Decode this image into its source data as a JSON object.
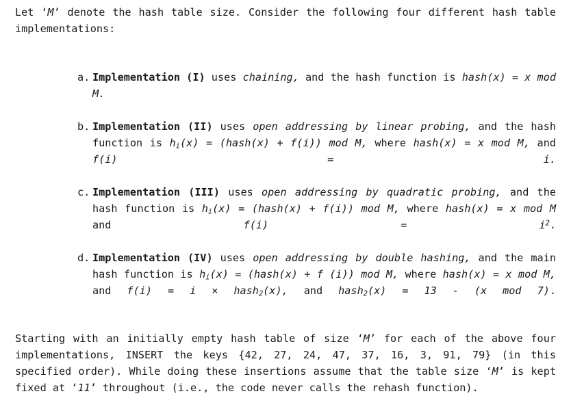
{
  "document": {
    "intro": {
      "before_m": "Let ",
      "m_symbol": "M",
      "after_m": " denote the hash table size. Consider the following four different hash table implementations:"
    },
    "list": [
      {
        "marker": "a.",
        "label": "Implementation (I)",
        "t1": " uses ",
        "em1": "chaining,",
        "t2": " and the hash function is ",
        "em2": "hash(x) = x mod M.",
        "t3": ""
      },
      {
        "marker": "b.",
        "label": "Implementation (II)",
        "t1": " uses ",
        "em1": "open addressing by linear probing,",
        "t2": " and the hash function is ",
        "h_main": "h",
        "h_sub": "i",
        "h_rest": "(x)",
        "t3": " = ",
        "em3": "(hash(x) + f(i)) mod M,",
        "t4": " where ",
        "em4": "hash(x) = x mod M,",
        "t5": " and ",
        "em5": "f(i) = i.",
        "t6": ""
      },
      {
        "marker": "c.",
        "label": "Implementation (III)",
        "t1": " uses ",
        "em1": "open addressing by quadratic probing,",
        "t2": " and the hash function is ",
        "h_main": "h",
        "h_sub": "i",
        "h_rest": "(x)",
        "t3": " = ",
        "em3": "(hash(x) + f(i)) mod M,",
        "t4": " where ",
        "em4": "hash(x) = x mod M",
        "t5": " and ",
        "em5": "f(i) = i",
        "sup": "2",
        "t6": "."
      },
      {
        "marker": "d.",
        "label": "Implementation (IV)",
        "t1": " uses ",
        "em1": "open addressing by double hashing,",
        "t2": " and the main hash function is ",
        "h_main": "h",
        "h_sub": "i",
        "h_rest": "(x)",
        "t3": " = ",
        "em3": "(hash(x) + f (i)) mod M,",
        "t4": " where ",
        "em4": "hash(x) = x mod M,",
        "t5": " and ",
        "em5a": "f(i) = i × hash",
        "em5_sub": "2",
        "em5b": "(x),",
        "t6": " and ",
        "em6a": "hash",
        "em6_sub": "2",
        "em6b": "(x) = 13 - (x mod 7)",
        "t7": "."
      }
    ],
    "closing": {
      "s1": "Starting with an initially empty hash table of size ",
      "m1": "M",
      "s2": " for each of the above four implementations, INSERT the keys {",
      "keys": "42, 27, 24, 47, 37, 16, 3, 91, 79",
      "s3": "} (in this specified order). While doing these insertions assume that the table size ",
      "m2": "M",
      "s4": " is kept fixed at ",
      "size_value": "11",
      "s5": " throughout (i.e., the code never calls the rehash function)."
    },
    "quote_open": "‘",
    "quote_close": "’",
    "colors": {
      "text": "#1a1a1a",
      "background": "#ffffff"
    }
  }
}
